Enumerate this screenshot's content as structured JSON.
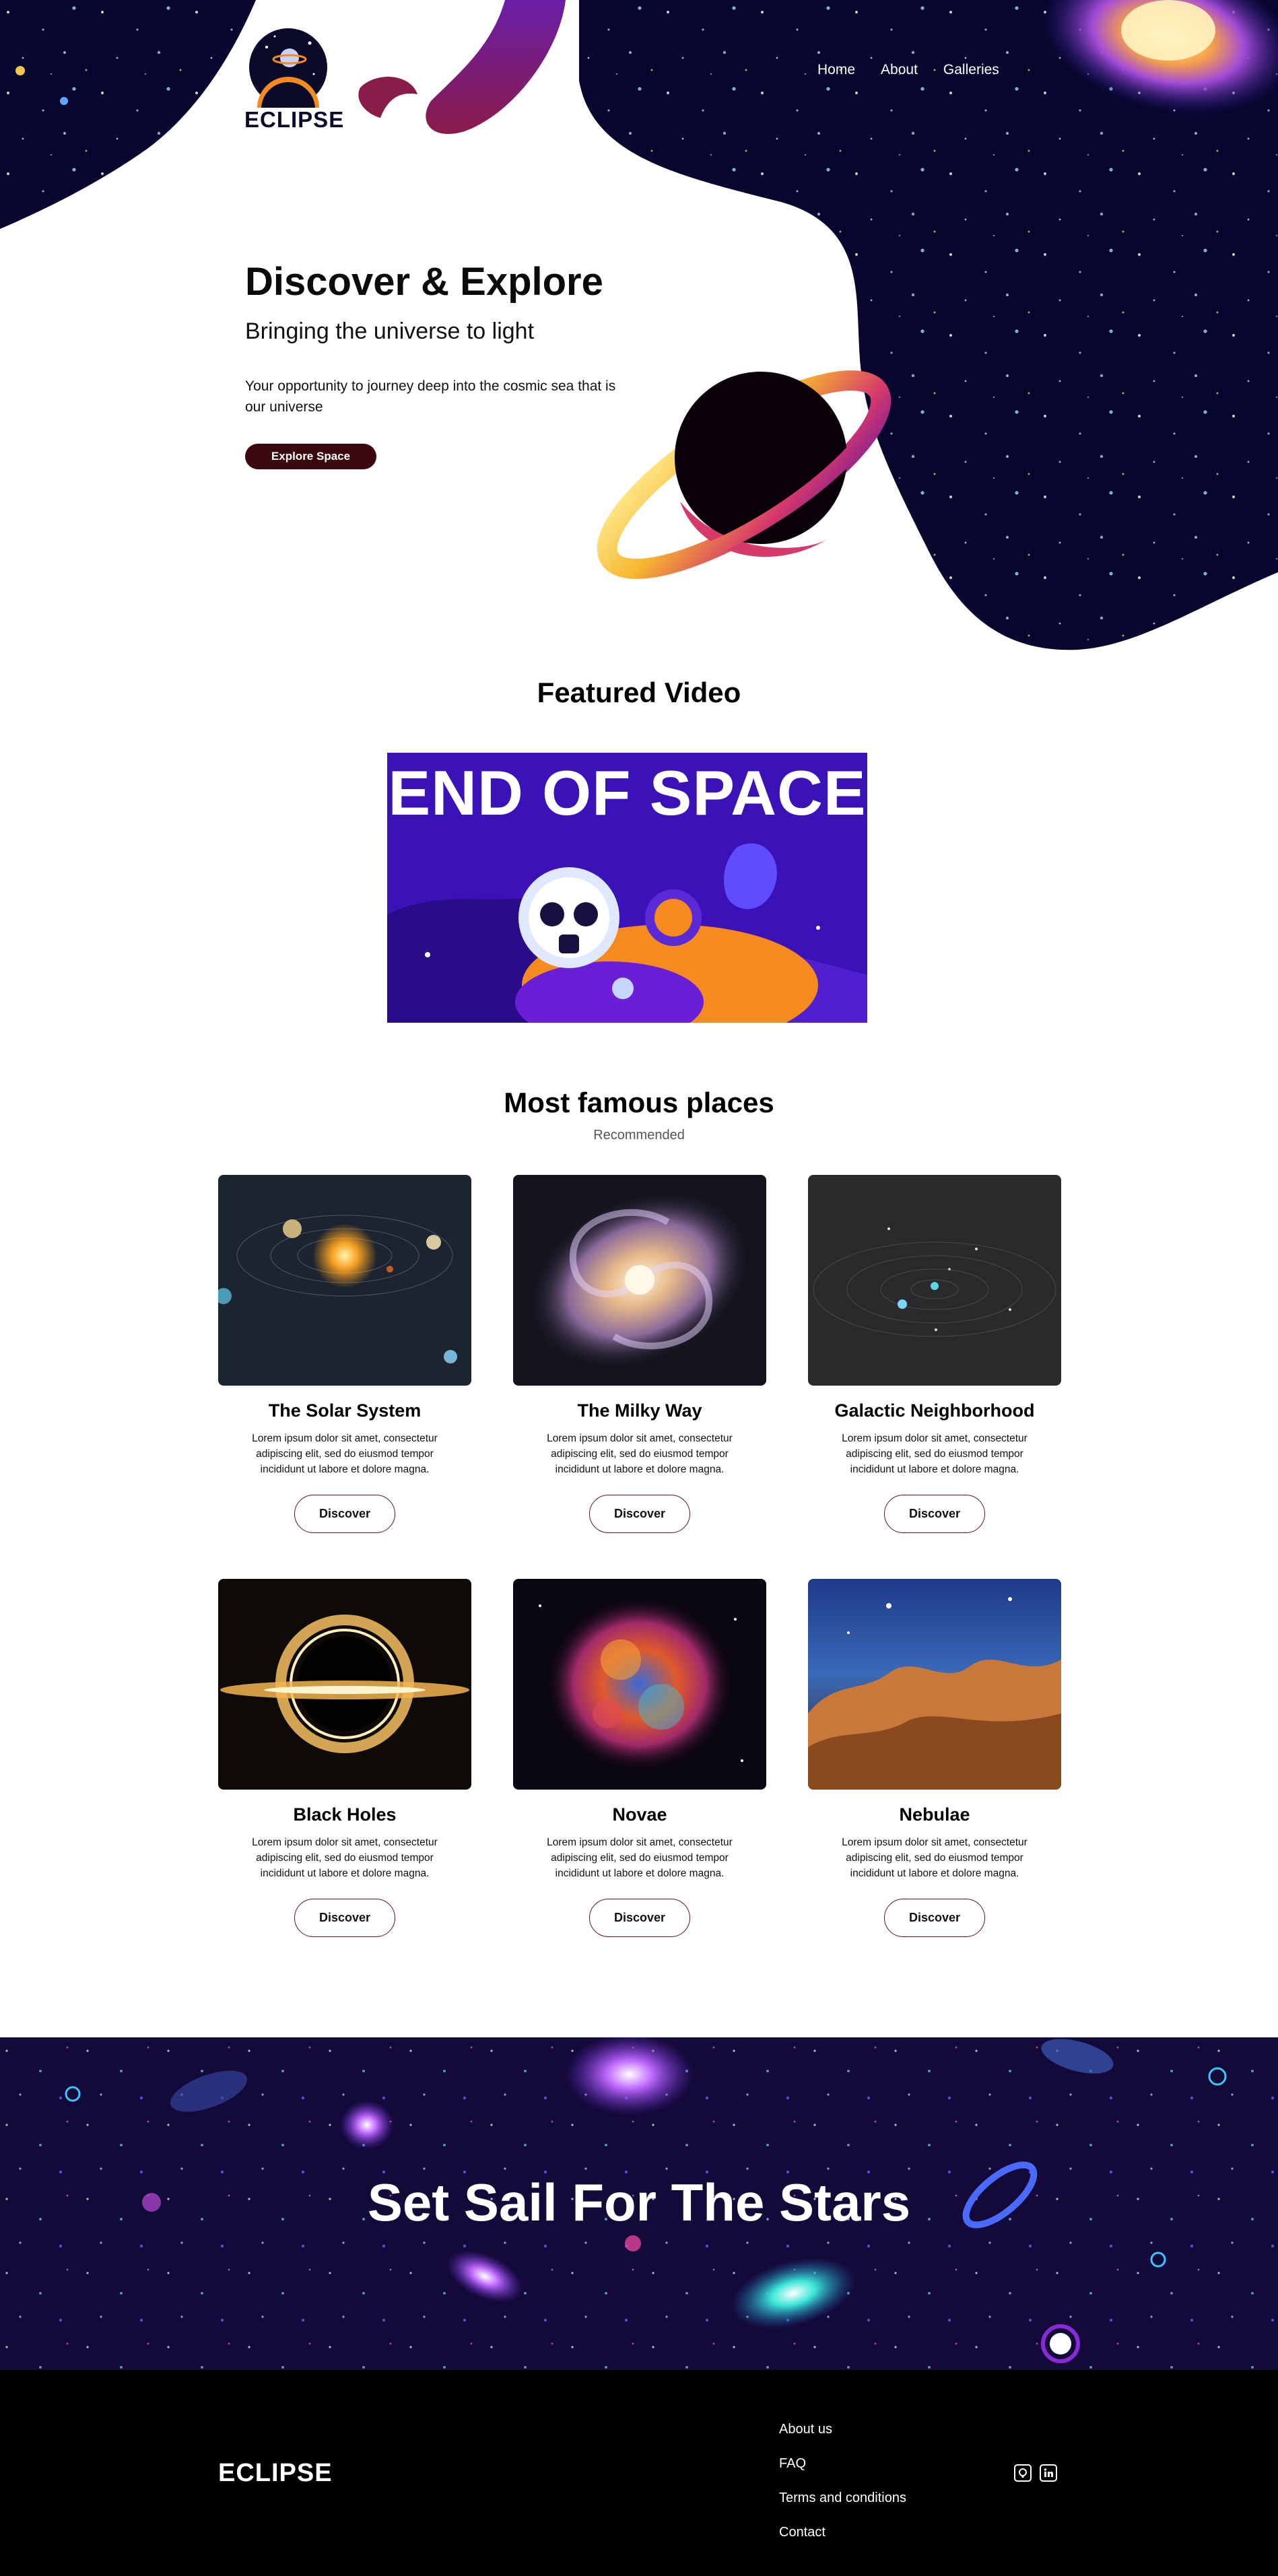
{
  "brand": {
    "name": "ECLIPSE"
  },
  "nav": {
    "items": [
      "Home",
      "About",
      "Galleries"
    ]
  },
  "hero": {
    "title": "Discover & Explore",
    "subtitle": "Bringing the universe to light",
    "text": "Your opportunity to journey deep into the cosmic sea that is our universe",
    "button": "Explore Space"
  },
  "featured": {
    "title": "Featured Video",
    "video_title": "END OF SPACE"
  },
  "places": {
    "title": "Most famous places",
    "subtitle": "Recommended",
    "cards": [
      {
        "title": "The Solar System",
        "text": "Lorem ipsum dolor sit amet, consectetur adipiscing elit, sed do eiusmod tempor incididunt ut labore et dolore magna.",
        "button": "Discover",
        "image": "solar-system-image"
      },
      {
        "title": "The Milky Way",
        "text": "Lorem ipsum dolor sit amet, consectetur adipiscing elit, sed do eiusmod tempor incididunt ut labore et dolore magna.",
        "button": "Discover",
        "image": "milky-way-image"
      },
      {
        "title": "Galactic Neighborhood",
        "text": "Lorem ipsum dolor sit amet, consectetur adipiscing elit, sed do eiusmod tempor incididunt ut labore et dolore magna.",
        "button": "Discover",
        "image": "galactic-neighborhood-image"
      },
      {
        "title": "Black Holes",
        "text": "Lorem ipsum dolor sit amet, consectetur adipiscing elit, sed do eiusmod tempor incididunt ut labore et dolore magna.",
        "button": "Discover",
        "image": "black-hole-image"
      },
      {
        "title": "Novae",
        "text": "Lorem ipsum dolor sit amet, consectetur adipiscing elit, sed do eiusmod tempor incididunt ut labore et dolore magna.",
        "button": "Discover",
        "image": "nova-image"
      },
      {
        "title": "Nebulae",
        "text": "Lorem ipsum dolor sit amet, consectetur adipiscing elit, sed do eiusmod tempor incididunt ut labore et dolore magna.",
        "button": "Discover",
        "image": "nebula-image"
      }
    ]
  },
  "banner": {
    "title": "Set Sail For The Stars"
  },
  "footer": {
    "logo": "ECLIPSE",
    "links": [
      "About us",
      "FAQ",
      "Terms and conditions",
      "Contact"
    ],
    "socials": [
      "github-icon",
      "linkedin-icon"
    ]
  },
  "colors": {
    "space_navy": "#07062e",
    "button_maroon": "#3b0810",
    "banner_bg": "#140a3a",
    "footer_bg": "#000000",
    "video_bg": "#3b12b8",
    "accent_orange": "#f58a1f"
  }
}
